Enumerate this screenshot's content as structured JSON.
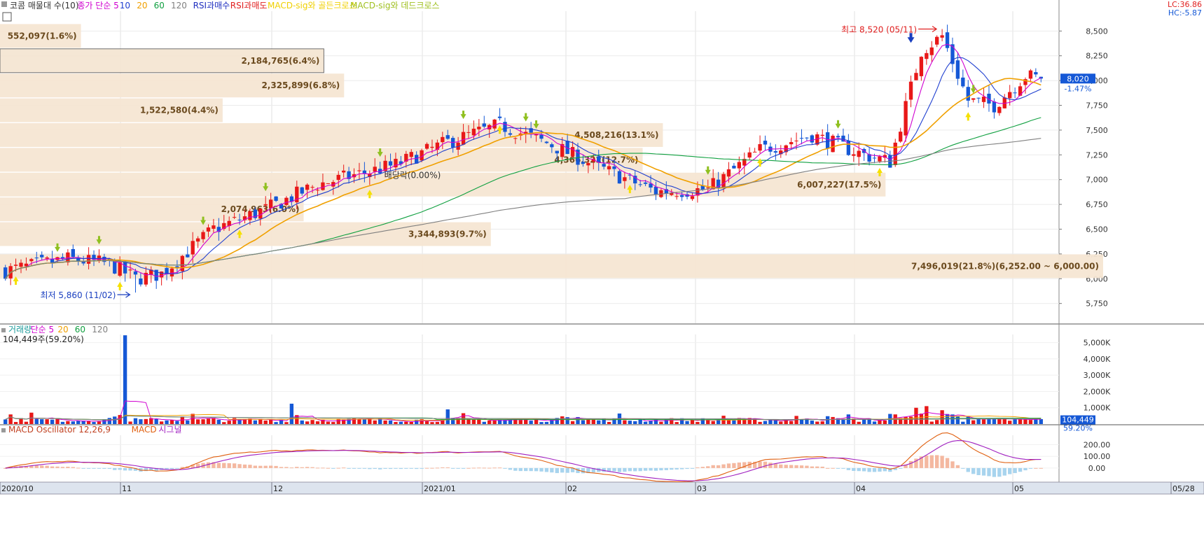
{
  "legend": {
    "top": [
      {
        "text": "코콤 매물대 수(10)",
        "color": "#333333"
      },
      {
        "text": "종가 단순 5",
        "color": "#d000d0"
      },
      {
        "text": "10",
        "color": "#2040d0"
      },
      {
        "text": "20",
        "color": "#f0a000"
      },
      {
        "text": "60",
        "color": "#10a040"
      },
      {
        "text": "120",
        "color": "#808080"
      },
      {
        "text": "RSI과매수",
        "color": "#2030c0"
      },
      {
        "text": "RSI과매도",
        "color": "#e02020"
      },
      {
        "text": "MACD-sig와 골든크로스",
        "color": "#f0d000"
      },
      {
        "text": "MACD-sig와 데드크로스",
        "color": "#a0c020"
      }
    ],
    "volume": [
      {
        "text": "거래량",
        "color": "#1a9a9a"
      },
      {
        "text": "단순 5",
        "color": "#d000d0"
      },
      {
        "text": "20",
        "color": "#f0a000"
      },
      {
        "text": "60",
        "color": "#10a040"
      },
      {
        "text": "120",
        "color": "#808080"
      }
    ],
    "volume_value": "104,449주(59.20%)",
    "macd": [
      {
        "text": "MACD Oscillator 12,26,9",
        "color": "#c04020"
      },
      {
        "text": "MACD",
        "color": "#e06010"
      },
      {
        "text": "시그널",
        "color": "#a020c0"
      }
    ]
  },
  "corner": {
    "lc": "LC:36.86",
    "hc": "HC:-5.87"
  },
  "annotations": {
    "high": "최고 8,520 (05/11)",
    "low": "최저 5,860 (11/02)",
    "dividend": "배당락(0.00%)"
  },
  "price_tag": {
    "value": "8,020",
    "change": "-1.47%"
  },
  "volume_tag": {
    "value": "104,449",
    "pct": "59.20%"
  },
  "chart_data": {
    "type": "candlestick",
    "price_axis": {
      "ticks": [
        "8,500",
        "8,250",
        "8,000",
        "7,750",
        "7,500",
        "7,250",
        "7,000",
        "6,750",
        "6,500",
        "6,250",
        "6,000",
        "5,750"
      ],
      "range": [
        5550,
        8700
      ]
    },
    "volume_axis": {
      "ticks": [
        "5,000K",
        "4,000K",
        "3,000K",
        "2,000K",
        "1,000K"
      ],
      "range": [
        0,
        5500
      ]
    },
    "macd_axis": {
      "ticks": [
        "200.00",
        "100.00",
        "0.00"
      ],
      "range": [
        -120,
        280
      ]
    },
    "x_labels": [
      "2020/10",
      "11",
      "12",
      "2021/01",
      "02",
      "03",
      "04",
      "05",
      "05/28"
    ],
    "volume_profile": [
      {
        "label": "552,097(1.6%)",
        "price": 8450,
        "share": 1.6
      },
      {
        "label": "2,184,765(6.4%)",
        "price": 8200,
        "share": 6.4
      },
      {
        "label": "2,325,899(6.8%)",
        "price": 7950,
        "share": 6.8
      },
      {
        "label": "1,522,580(4.4%)",
        "price": 7700,
        "share": 4.4
      },
      {
        "label": "4,508,216(13.1%)",
        "price": 7450,
        "share": 13.1
      },
      {
        "label": "4,366,322(12.7%)",
        "price": 7200,
        "share": 12.7
      },
      {
        "label": "6,007,227(17.5%)",
        "price": 6950,
        "share": 17.5
      },
      {
        "label": "2,074,963(6.0%)",
        "price": 6700,
        "share": 6.0
      },
      {
        "label": "3,344,893(9.7%)",
        "price": 6450,
        "share": 9.7
      },
      {
        "label": "7,496,019(21.8%)(6,252.00 ~ 6,000.00)",
        "price": 6126,
        "share": 21.8
      }
    ],
    "close_start": 6080,
    "close_end": 8020,
    "high": 8520,
    "low": 5860
  }
}
